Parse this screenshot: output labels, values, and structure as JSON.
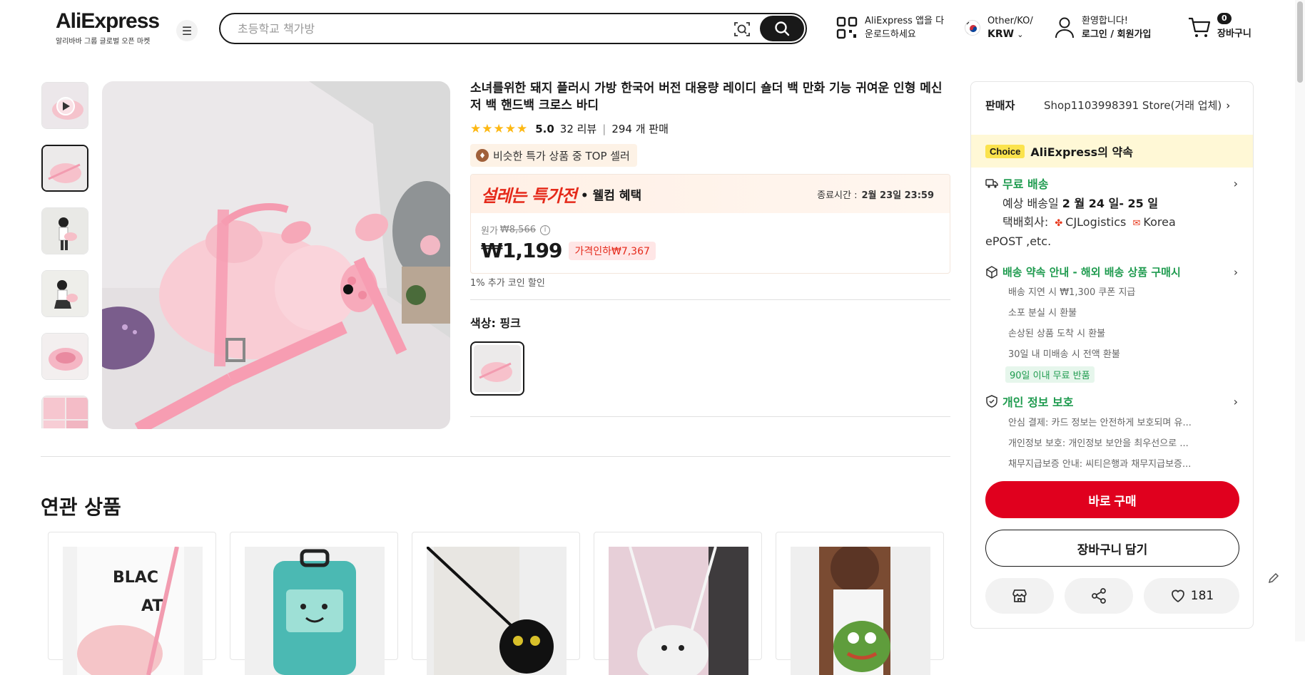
{
  "header": {
    "brand": "AliExpress",
    "tagline": "알리바바 그룹 글로벌 오픈 마켓",
    "search_placeholder": "초등학교 책가방",
    "app_line1": "AliExpress 앱을 다",
    "app_line2": "운로드하세요",
    "lang_line1": "Other/KO/",
    "lang_line2": "KRW",
    "user_line1": "환영합니다!",
    "user_line2": "로그인 / 회원가입",
    "cart_count": "0",
    "cart_label": "장바구니"
  },
  "product": {
    "title": "소녀를위한 돼지 플러시 가방 한국어 버전 대용량 레이디 숄더 백 만화 기능 귀여운 인형 메신저 백 핸드백 크로스 바디",
    "stars": "★★★★★",
    "rating": "5.0",
    "reviews": "32 리뷰",
    "sep": "|",
    "sold": "294 개 판매",
    "top_seller": "비슷한 특가 상품 중 TOP 셀러",
    "deal_name": "설레는 특가전",
    "deal_sub": "• 웰컴 혜택",
    "end_label": "종료시간 :",
    "end_time": "2월 23일 23:59",
    "orig_label": "원가",
    "orig_price": "₩8,566",
    "price": "₩1,199",
    "discount": "가격인하₩7,367",
    "coin_note": "1% 추가 코인 할인",
    "color_label": "색상: 핑크"
  },
  "related": {
    "title": "연관 상품"
  },
  "panel": {
    "seller_label": "판매자",
    "seller_name": "Shop1103998391 Store(거래 업체)",
    "choice_badge": "Choice",
    "choice_title": "AliExpress의 약속",
    "ship_title": "무료 배송",
    "ship_eta_prefix": "예상 배송일",
    "ship_eta": "2 월 24 일- 25 일",
    "carrier_label": "택배회사:",
    "carrier_cj": "CJLogistics",
    "carrier_korea": "Korea",
    "carrier_etc": "ePOST ,etc.",
    "promise_title": "배송 약속 안내 - 해외 배송 상품 구매시",
    "promise_items": [
      "배송 지연 시 ₩1,300 쿠폰 지급",
      "소포 분실 시 환불",
      "손상된 상품 도착 시 환불",
      "30일 내 미배송 시 전액 환불"
    ],
    "promise_tag": "90일 이내 무료 반품",
    "privacy_title": "개인 정보 보호",
    "privacy_items": [
      "안심 결제: 카드 정보는 안전하게 보호되며 유...",
      "개인정보 보호: 개인정보 보안을 최우선으로 ...",
      "채무지급보증 안내: 씨티은행과 채무지급보증..."
    ],
    "buy_now": "바로 구매",
    "add_cart": "장바구니 담기",
    "wishlist_count": "181"
  },
  "colors": {
    "accent_red": "#e0001e",
    "green": "#1f9b4f",
    "choice_yellow": "#fbe34d"
  }
}
